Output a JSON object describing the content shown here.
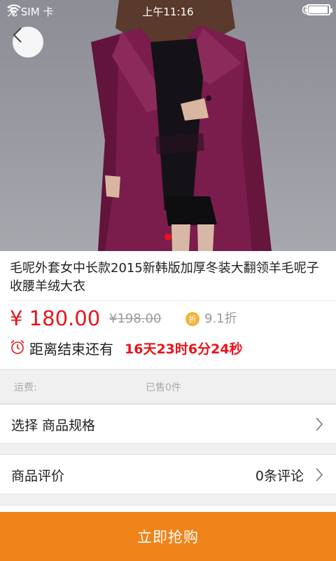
{
  "status_bar": {
    "carrier": "无 SIM 卡",
    "time": "上午11:16",
    "battery_level": 0.9
  },
  "icons": {
    "back": "chevron-left-icon",
    "wifi": "wifi-icon",
    "rotation_lock": "rotation-lock-icon",
    "battery": "battery-icon",
    "clock": "alarm-clock-icon",
    "chevron": "chevron-right-icon"
  },
  "carousel": {
    "total_slides": 1,
    "active_slide": 1
  },
  "product": {
    "title": "毛呢外套女中长款2015新韩版加厚冬装大翻领羊毛呢子收腰羊绒大衣",
    "price": "¥ 180.00",
    "original_price": "¥198.00",
    "discount_badge": "折",
    "discount_text": "9.1折",
    "countdown_label": "距离结束还有",
    "countdown_value": "16天23时6分24秒"
  },
  "shipping": {
    "fee_label": "运费:",
    "sold_label": "已售0件"
  },
  "spec_row": {
    "label": "选择 商品规格"
  },
  "review_row": {
    "label": "商品评价",
    "value": "0条评论"
  },
  "buy_button": {
    "label": "立即抢购"
  },
  "colors": {
    "accent_red": "#e8141c",
    "buy_orange": "#f0831a",
    "discount_gold": "#f4b43a",
    "coat_purple": "#7a1d4c"
  }
}
